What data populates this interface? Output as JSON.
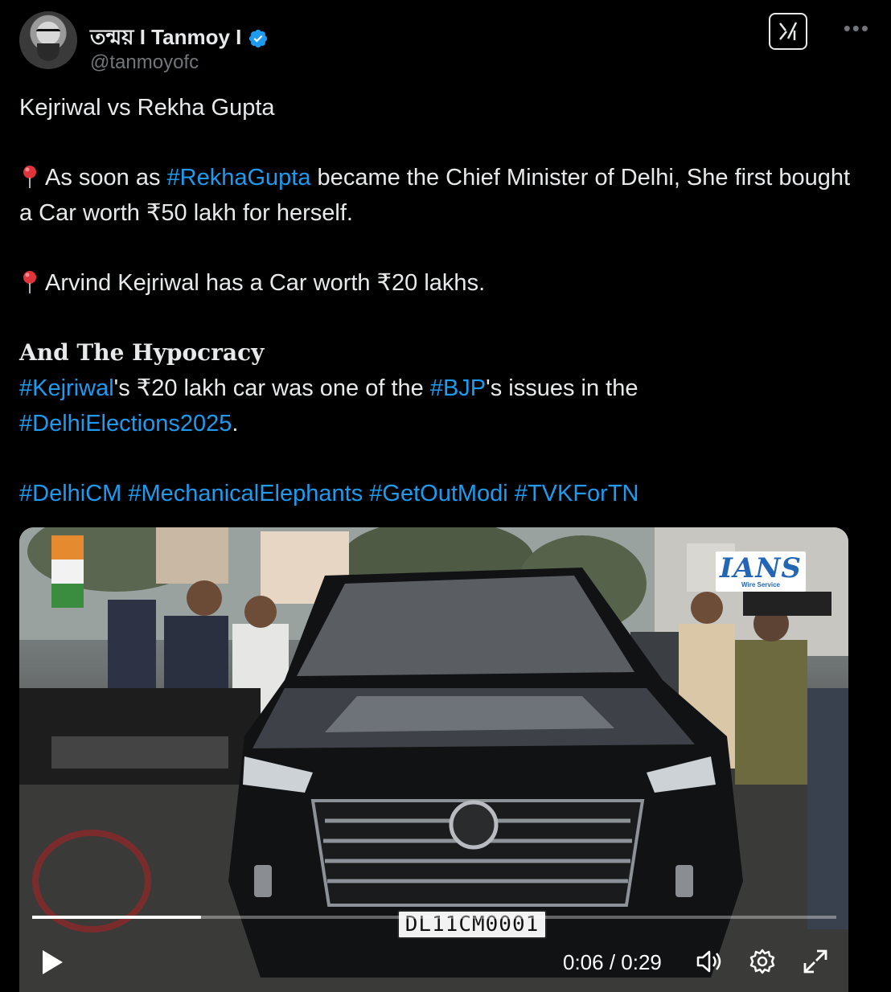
{
  "author": {
    "display_name": "তন্ময় I Tanmoy I",
    "handle": "@tanmoyofc",
    "verified": true
  },
  "icons": {
    "grok": "grok-icon",
    "more": "more-icon",
    "pin": "round-pushpin-icon",
    "play": "play-icon",
    "volume": "volume-icon",
    "settings": "gear-icon",
    "fullscreen": "expand-icon"
  },
  "colors": {
    "hashtag": "#1d9bf0",
    "verified": "#1d9bf0",
    "background": "#000000"
  },
  "tweet": {
    "line1": "Kejriwal vs Rekha Gupta",
    "p2_before": "As soon as ",
    "p2_hashtag": "#RekhaGupta",
    "p2_after": " became the Chief Minister of Delhi, She first bought a Car worth ₹50 lakh for herself.",
    "p3": "Arvind Kejriwal has a Car worth ₹20 lakhs.",
    "p4_heading": "And The Hypocracy",
    "p4_ht1": "#Kejriwal",
    "p4_mid1": "'s ₹20 lakh car was one of the ",
    "p4_ht2": "#BJP",
    "p4_mid2": "'s issues in the ",
    "p4_ht3": "#DelhiElections2025",
    "p4_end": ".",
    "tags": [
      "#DelhiCM",
      "#MechanicalElephants",
      "#GetOutModi",
      "#TVKForTN"
    ]
  },
  "video": {
    "watermark_main": "IANS",
    "watermark_sub": "Wire Service",
    "plate_text": "DL11CM0001",
    "time_display": "0:06 / 0:29",
    "progress_fraction": 0.21
  }
}
